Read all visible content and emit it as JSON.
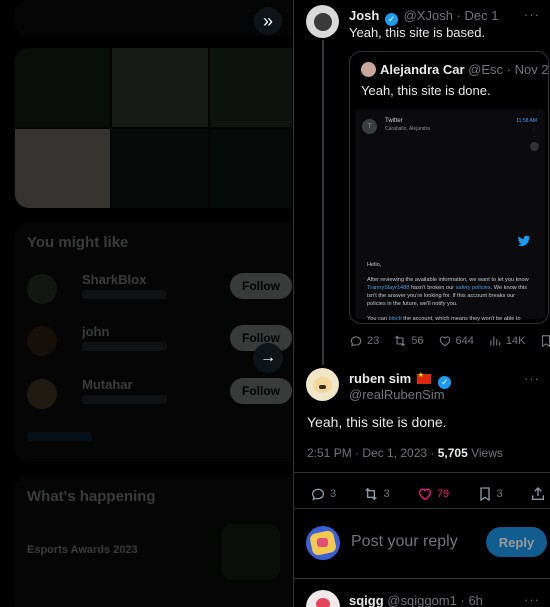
{
  "left_panel": {
    "expand_icon": "double-chevron-right",
    "next_icon": "arrow-right",
    "you_might_like": {
      "title": "You might like",
      "accounts": [
        {
          "name": "SharkBlox",
          "follow_label": "Follow"
        },
        {
          "name": "john",
          "follow_label": "Follow"
        },
        {
          "name": "Mutahar",
          "follow_label": "Follow"
        }
      ]
    },
    "whats_happening": {
      "title": "What's happening",
      "trend": "Esports Awards 2023"
    }
  },
  "thread": {
    "parent": {
      "name": "Josh",
      "handle": "@XJosh",
      "date": "· Dec 1",
      "text": "Yeah, this site is based.",
      "quote": {
        "name": "Alejandra Car",
        "handle": "@Esc",
        "date": "· Nov 27",
        "text": "Yeah, this site is done.",
        "email": {
          "avatar_letter": "T",
          "from": "Twitter",
          "to": "Caraballo, Alejandra",
          "time": "11:58 AM",
          "greeting": "Hello,",
          "p1_before": "After reviewing the available information, we want to let you know ",
          "p1_link1": "TrannySlayr1488",
          "p1_mid": " hasn't broken our ",
          "p1_link2": "safety policies",
          "p1_after": ". We know this isn't the answer you're looking for. If this account breaks our policies in the future, we'll notify you.",
          "p2_before": "You can ",
          "p2_link": "block",
          "p2_after": " the account, which means they won't be able to follow you, see your Tweets, or message you."
        }
      },
      "stats": {
        "replies": "23",
        "reposts": "56",
        "likes": "644",
        "views": "14K"
      }
    },
    "main": {
      "name": "ruben sim",
      "handle": "@realRubenSim",
      "text": "Yeah, this site is done.",
      "time": "2:51 PM · Dec 1, 2023 · ",
      "views_count": "5,705",
      "views_label": " Views",
      "stats": {
        "replies": "3",
        "reposts": "3",
        "likes": "79",
        "bookmarks": "3"
      },
      "colors": {
        "like": "#f91880",
        "accent": "#1d9bf0"
      }
    },
    "reply_box": {
      "placeholder": "Post your reply",
      "button_label": "Reply"
    },
    "next_reply": {
      "name": "sqigg",
      "handle": "@sqiggom1",
      "date": "· 6h"
    }
  }
}
